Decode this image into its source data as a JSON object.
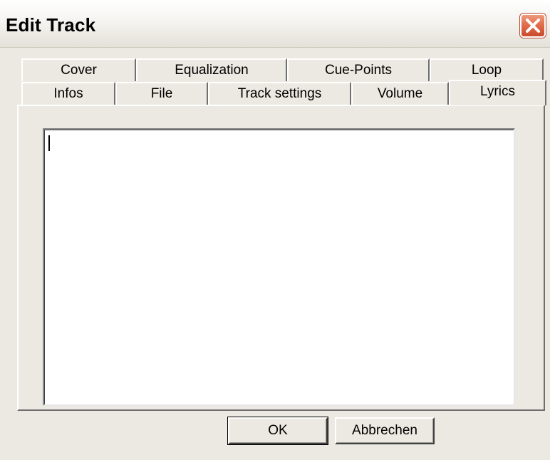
{
  "window": {
    "title": "Edit Track"
  },
  "tabs": {
    "back_row": [
      {
        "label": "Cover"
      },
      {
        "label": "Equalization"
      },
      {
        "label": "Cue-Points"
      },
      {
        "label": "Loop"
      }
    ],
    "front_row": [
      {
        "label": "Infos"
      },
      {
        "label": "File"
      },
      {
        "label": "Track settings"
      },
      {
        "label": "Volume"
      },
      {
        "label": "Lyrics",
        "selected": true
      }
    ]
  },
  "lyrics": {
    "text": ""
  },
  "buttons": {
    "ok": "OK",
    "cancel": "Abbrechen"
  },
  "colors": {
    "dialog_bg": "#ebe9e1",
    "close_button": "#e06b4a"
  }
}
